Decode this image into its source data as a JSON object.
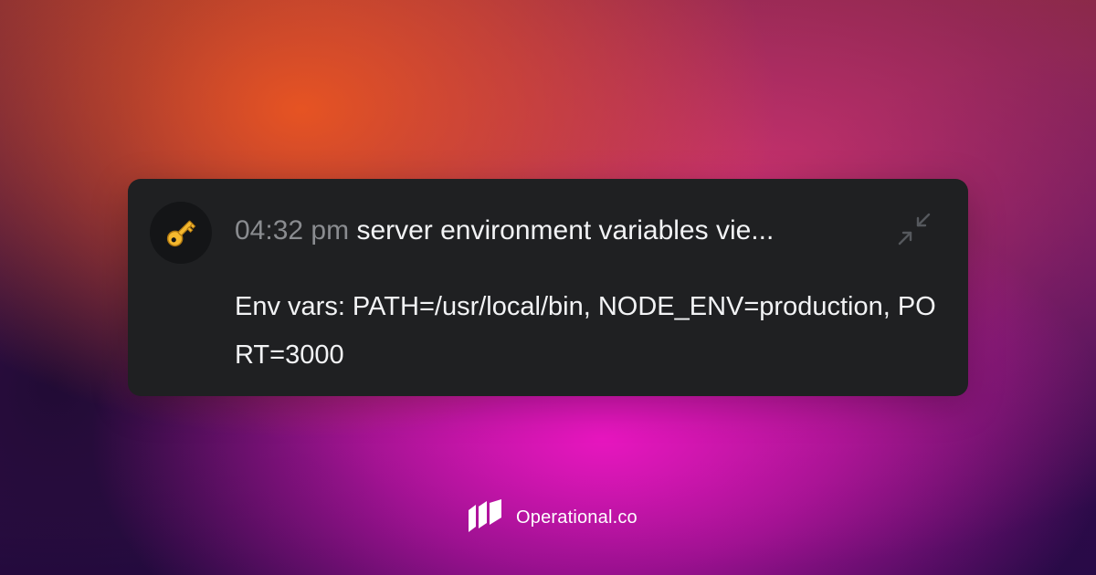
{
  "notification": {
    "icon": "key-icon",
    "time": "04:32 pm",
    "title": "server environment variables vie...",
    "message": "Env vars: PATH=/usr/local/bin, NODE_ENV=production, PORT=3000",
    "collapse_icon": "collapse-arrows-icon"
  },
  "brand": {
    "logo_icon": "operational-logo-icon",
    "name": "Operational.co"
  },
  "colors": {
    "card_background": "#1f2022",
    "time_text": "#8a8c90",
    "primary_text": "#f2f3f5",
    "gradient_orange": "#ec5620",
    "gradient_magenta": "#ee16c4",
    "background_dark": "#2a0b3d"
  }
}
